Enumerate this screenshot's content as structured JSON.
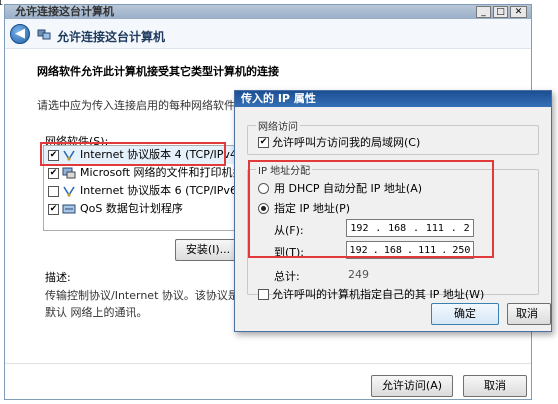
{
  "corner_label": "1",
  "window": {
    "title": "允许连接这台计算机",
    "nav_title": "允许连接这台计算机",
    "heading": "网络软件允许此计算机接受其它类型计算机的连接",
    "instruction": "请选中应为传入连接启用的每种网络软件类",
    "list_label": "网络软件(S):",
    "items": [
      {
        "label": "Internet 协议版本 4 (TCP/IPv4)",
        "checked": true,
        "icon": "network-protocol-icon"
      },
      {
        "label": "Microsoft 网络的文件和打印机共享",
        "checked": true,
        "icon": "printer-share-icon"
      },
      {
        "label": "Internet 协议版本 6 (TCP/IPv6)",
        "checked": false,
        "icon": "network-protocol-icon"
      },
      {
        "label": "QoS 数据包计划程序",
        "checked": true,
        "icon": "qos-icon"
      }
    ],
    "install_label": "安装(I)...",
    "desc_label": "描述:",
    "description": "传输控制协议/Internet 协议。该协议是默认 网络上的通讯。",
    "allow_label": "允许访问(A)",
    "cancel_label": "取消"
  },
  "dialog": {
    "title": "传入的 IP 属性",
    "network_access_legend": "网络访问",
    "allow_lan_label": "允许呼叫方访问我的局域网(C)",
    "allow_lan_checked": true,
    "ip_assign_legend": "IP 地址分配",
    "dhcp_label": "用 DHCP 自动分配 IP 地址(A)",
    "specify_label": "指定 IP 地址(P)",
    "selected_option": "specify",
    "from_label": "从(F):",
    "from_ip": [
      "192",
      "168",
      "111",
      "2"
    ],
    "to_label": "到(T):",
    "to_ip": [
      "192",
      "168",
      "111",
      "250"
    ],
    "total_label": "总计:",
    "total_value": "249",
    "allow_own_ip_label": "允许呼叫的计算机指定自己的其 IP 地址(W)",
    "allow_own_ip_checked": false,
    "ok_label": "确定",
    "cancel_label": "取消"
  },
  "colors": {
    "highlight_box": "#e23a3a",
    "dialog_title_bg": "#1c4f92"
  }
}
